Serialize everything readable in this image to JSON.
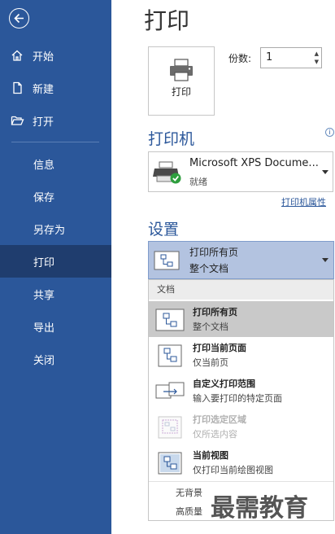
{
  "sidebar": {
    "back_icon": "back-arrow-icon",
    "items_top": [
      {
        "label": "开始",
        "icon": "home-icon"
      },
      {
        "label": "新建",
        "icon": "new-document-icon"
      },
      {
        "label": "打开",
        "icon": "open-folder-icon"
      }
    ],
    "items_bottom": [
      {
        "label": "信息"
      },
      {
        "label": "保存"
      },
      {
        "label": "另存为"
      },
      {
        "label": "打印",
        "active": true
      },
      {
        "label": "共享"
      },
      {
        "label": "导出"
      },
      {
        "label": "关闭"
      }
    ],
    "bg_color": "#2b579a",
    "active_color": "#1f3d6e"
  },
  "main": {
    "title": "打印",
    "print_button": {
      "label": "打印",
      "icon": "printer-icon"
    },
    "copies": {
      "label": "份数:",
      "value": "1"
    },
    "printer_section": {
      "heading": "打印机",
      "printer_name": "Microsoft XPS Docume...",
      "printer_status": "就绪",
      "properties_link": "打印机属性"
    },
    "settings_section": {
      "heading": "设置",
      "selected": {
        "title": "打印所有页",
        "subtitle": "整个文档"
      },
      "dropdown": {
        "header": "文档",
        "items": [
          {
            "title": "打印所有页",
            "subtitle": "整个文档",
            "icon": "all-pages-icon",
            "selected": true
          },
          {
            "title": "打印当前页面",
            "subtitle": "仅当前页",
            "icon": "current-page-icon"
          },
          {
            "title": "自定义打印范围",
            "subtitle": "输入要打印的特定页面",
            "icon": "custom-range-icon"
          },
          {
            "title": "打印选定区域",
            "subtitle": "仅所选内容",
            "icon": "selection-icon",
            "disabled": true
          },
          {
            "title": "当前视图",
            "subtitle": "仅打印当前绘图视图",
            "icon": "current-view-icon"
          }
        ],
        "options": [
          "无背景",
          "高质量"
        ]
      }
    },
    "accent_color": "#2b579a"
  },
  "watermark": "最需教育"
}
